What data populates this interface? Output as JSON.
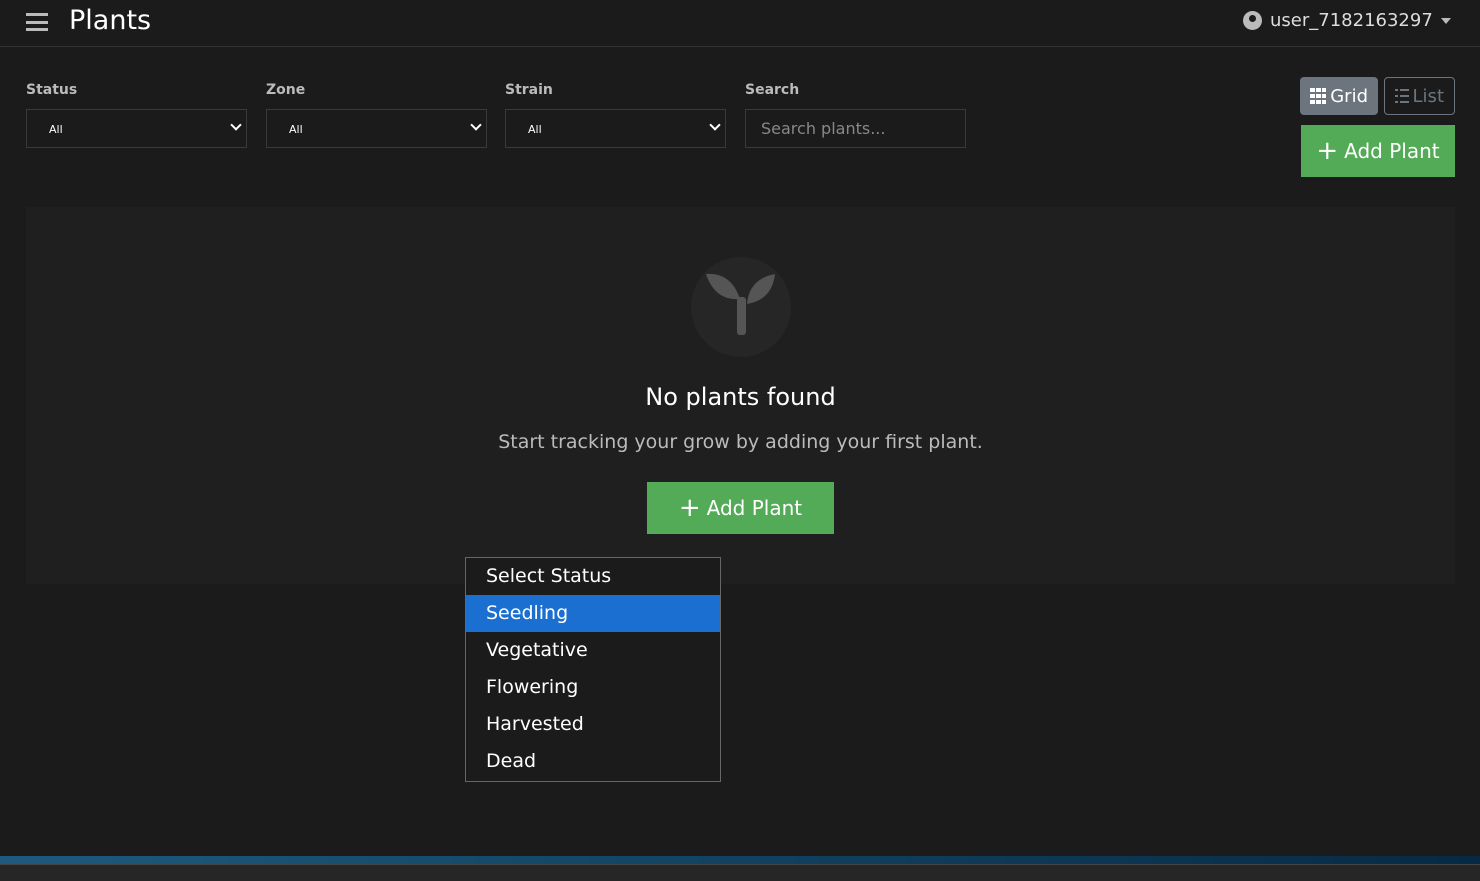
{
  "header": {
    "title": "Plants",
    "username": "user_7182163297"
  },
  "filters": {
    "status": {
      "label": "Status",
      "value": "All"
    },
    "zone": {
      "label": "Zone",
      "value": "All"
    },
    "strain": {
      "label": "Strain",
      "value": "All"
    },
    "search": {
      "label": "Search",
      "placeholder": "Search plants..."
    }
  },
  "view": {
    "grid": "Grid",
    "list": "List"
  },
  "add_plant": "Add Plant",
  "empty": {
    "title": "No plants found",
    "subtitle": "Start tracking your grow by adding your first plant.",
    "button": "Add Plant"
  },
  "status_dropdown": {
    "options": [
      "Select Status",
      "Seedling",
      "Vegetative",
      "Flowering",
      "Harvested",
      "Dead"
    ],
    "highlighted": "Seedling"
  },
  "colors": {
    "accent": "#54ab57",
    "highlight": "#1a6fd0"
  }
}
